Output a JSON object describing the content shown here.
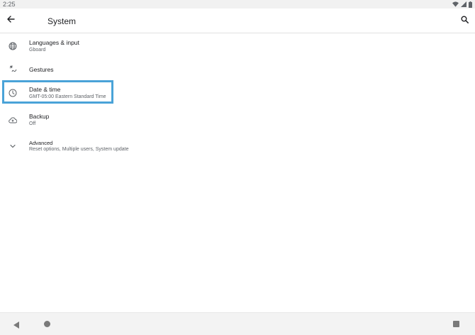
{
  "status_bar": {
    "time": "2:25"
  },
  "app_bar": {
    "title": "System"
  },
  "items": [
    {
      "title": "Languages & input",
      "summary": "Gboard",
      "icon": "globe-icon"
    },
    {
      "title": "Gestures",
      "summary": "",
      "icon": "gestures-icon"
    },
    {
      "title": "Date & time",
      "summary": "GMT-05:00 Eastern Standard Time",
      "icon": "clock-icon"
    },
    {
      "title": "Backup",
      "summary": "Off",
      "icon": "cloud-upload-icon"
    },
    {
      "title": "Advanced",
      "summary": "Reset options, Multiple users, System update",
      "icon": "chevron-down-icon"
    }
  ],
  "colors": {
    "highlight": "#4aa3d8",
    "accent_text": "#202124",
    "secondary_text": "#5f6368"
  }
}
